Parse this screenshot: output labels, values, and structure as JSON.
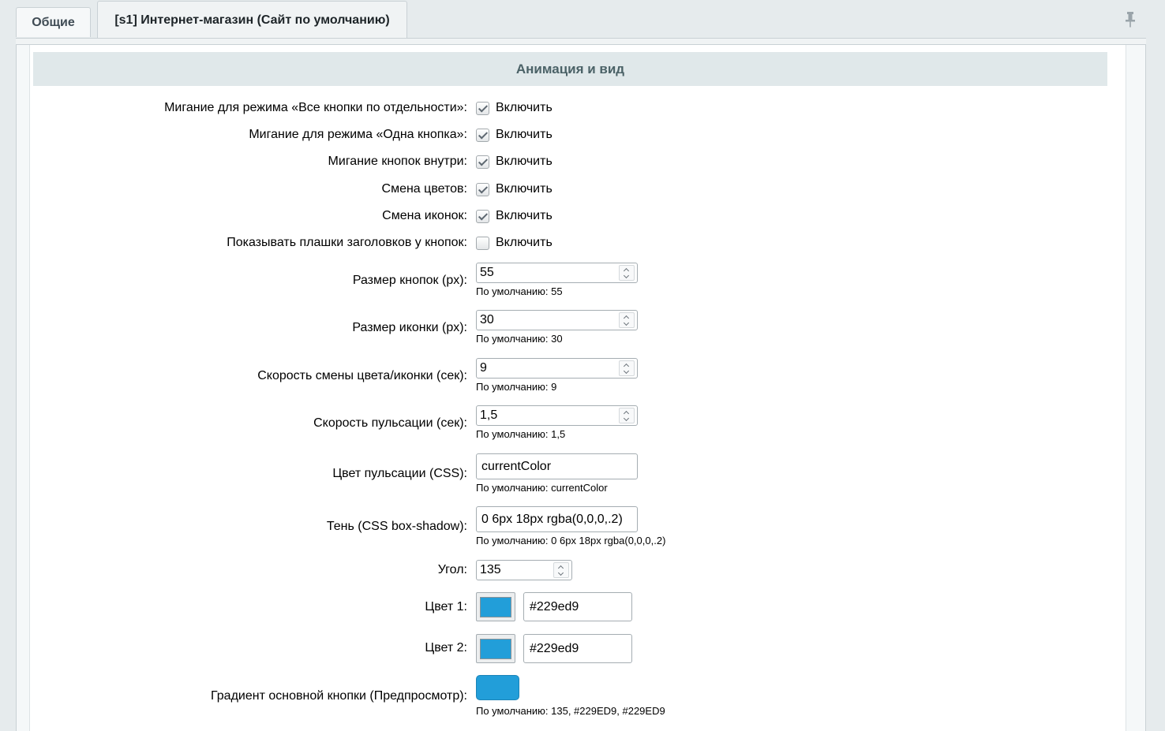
{
  "tabs": [
    {
      "label": "Общие"
    },
    {
      "label": "[s1] Интернет-магазин (Сайт по умолчанию)"
    }
  ],
  "section": {
    "title": "Анимация и вид"
  },
  "checkbox_rows": [
    {
      "label": "Мигание для режима «Все кнопки по отдельности»:",
      "option": "Включить",
      "checked": true
    },
    {
      "label": "Мигание для режима «Одна кнопка»:",
      "option": "Включить",
      "checked": true
    },
    {
      "label": "Мигание кнопок внутри:",
      "option": "Включить",
      "checked": true
    },
    {
      "label": "Смена цветов:",
      "option": "Включить",
      "checked": true
    },
    {
      "label": "Смена иконок:",
      "option": "Включить",
      "checked": true
    },
    {
      "label": "Показывать плашки заголовков у кнопок:",
      "option": "Включить",
      "checked": false
    }
  ],
  "number_rows": [
    {
      "label": "Размер кнопок (px):",
      "value": "55",
      "hint": "По умолчанию: 55"
    },
    {
      "label": "Размер иконки (px):",
      "value": "30",
      "hint": "По умолчанию: 30"
    },
    {
      "label": "Скорость смены цвета/иконки (сек):",
      "value": "9",
      "hint": "По умолчанию: 9"
    },
    {
      "label": "Скорость пульсации (сек):",
      "value": "1,5",
      "hint": "По умолчанию: 1,5"
    }
  ],
  "text_rows": [
    {
      "label": "Цвет пульсации (CSS):",
      "value": "currentColor",
      "hint": "По умолчанию: currentColor"
    },
    {
      "label": "Тень (CSS box-shadow):",
      "value": "0 6px 18px rgba(0,0,0,.2)",
      "hint": "По умолчанию: 0 6px 18px rgba(0,0,0,.2)"
    }
  ],
  "angle": {
    "label": "Угол:",
    "value": "135"
  },
  "colors": [
    {
      "label": "Цвет 1:",
      "value": "#229ed9",
      "swatch": "#229ed9"
    },
    {
      "label": "Цвет 2:",
      "value": "#229ed9",
      "swatch": "#229ed9"
    }
  ],
  "gradient": {
    "label": "Градиент основной кнопки (Предпросмотр):",
    "hint": "По умолчанию: 135, #229ED9, #229ED9",
    "color_start": "#229ed9",
    "color_end": "#229ed9"
  },
  "icons": {
    "pin": "pin-icon"
  }
}
